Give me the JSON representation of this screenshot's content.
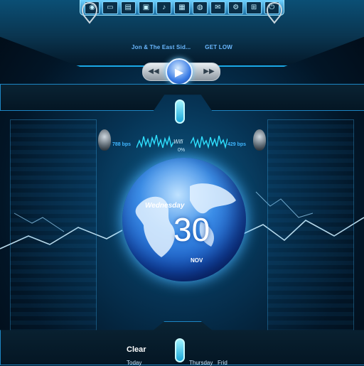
{
  "media": {
    "artist": "Jon & The East Sid...",
    "track": "GET LOW",
    "prev_label": "◀◀",
    "play_label": "▶",
    "next_label": "▶▶"
  },
  "network": {
    "download": "788 bps",
    "upload": "429 bps",
    "connection_label": "Wifi",
    "signal": "0%"
  },
  "calendar": {
    "weekday": "Wednesday",
    "day": "30",
    "month": "NOV"
  },
  "weather": {
    "condition": "Clear",
    "forecast_days": [
      "Today",
      "Thursday",
      "Frid"
    ]
  },
  "dock": {
    "icons": [
      "planet-icon",
      "monitor-icon",
      "folder-icon",
      "photo-icon",
      "music-icon",
      "document-icon",
      "globe-icon",
      "mail-icon",
      "settings-icon",
      "network-icon",
      "power-icon"
    ]
  },
  "colors": {
    "accent": "#1aa8e6",
    "glow": "#4ab3ff",
    "text_blue": "#3fb6ff"
  }
}
